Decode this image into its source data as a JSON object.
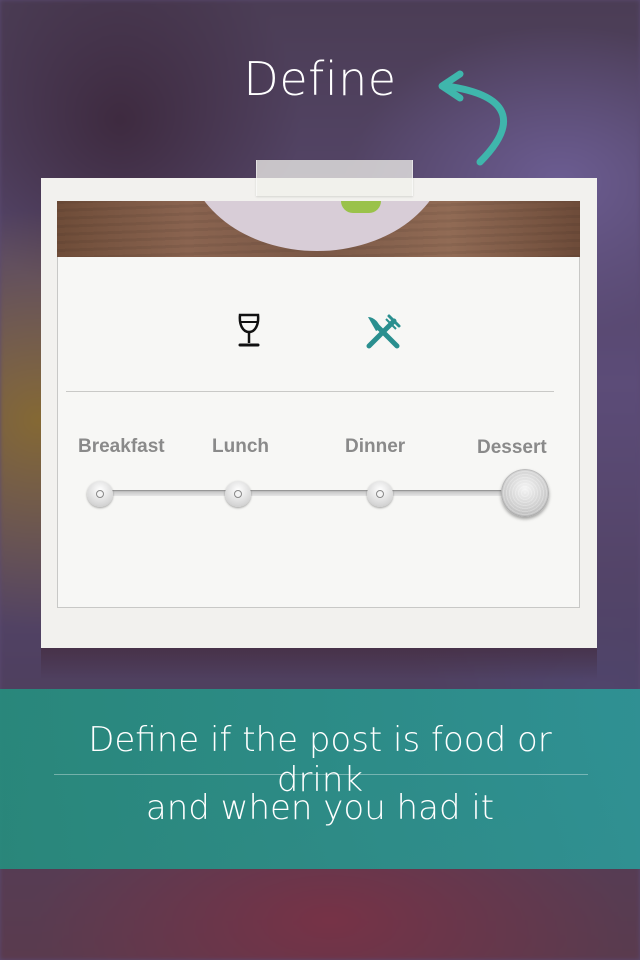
{
  "header": {
    "title": "Define"
  },
  "card": {
    "type_icons": [
      {
        "name": "wine-glass-icon",
        "selected": false
      },
      {
        "name": "fork-knife-icon",
        "selected": true,
        "color": "#2a8f8f"
      }
    ],
    "meal_slider": {
      "stops": [
        "Breakfast",
        "Lunch",
        "Dinner",
        "Dessert"
      ],
      "selected": "Dessert"
    }
  },
  "banner": {
    "line1": "Define if the post is food or drink",
    "line2": "and when you had it"
  },
  "colors": {
    "accent": "#2a8f8f",
    "banner": "#2b9088"
  }
}
